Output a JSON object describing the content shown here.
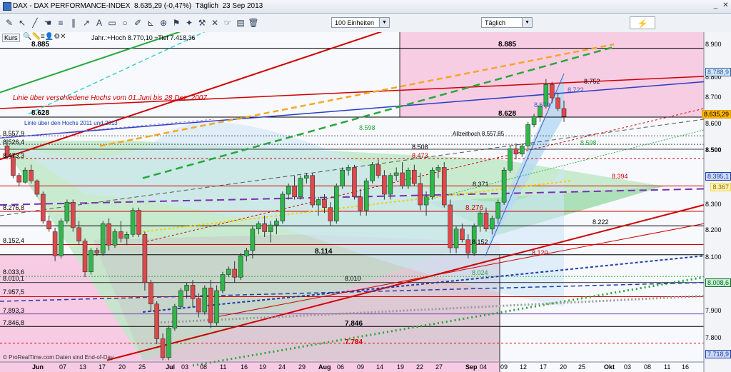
{
  "window": {
    "title": "DAX - DAX PERFORMANCE-INDEX",
    "price": "8.635,29 (-0,47%)",
    "interval": "Täglich",
    "date": "23 Sep 2013"
  },
  "toolbar": {
    "units_value": "100 Einheiten",
    "period_value": "Täglich"
  },
  "chart": {
    "kurs_label": "Kurs",
    "hilo": "Jahr.:+Hoch 8.770,10 ÷Tief 7.418,36",
    "annotation_red": "Linie über verschiedene Hochs vom 01.Juni bis 28.Dez. 2007",
    "annotation_blue": "Linie über den Hochs 2011 und 2013",
    "allzeithoch": "Allzeithoch 8.557,85",
    "footer": "© ProRealTime.com  Daten sind End-of-Day",
    "big_labels": {
      "l8885a": "8.885",
      "l8885b": "8.885",
      "l8628a": "8.628",
      "l8628b": "8.628",
      "l8114": "8.114",
      "l7846": "7.846",
      "l7784": "7.784"
    },
    "small_labels": {
      "l8752": "8.752",
      "l8722": "8.722",
      "l8679": "8.679",
      "l8598": "8.598",
      "l8598b": "8.598",
      "l8557": "8.557,9",
      "l8526": "8.526,4",
      "l8508": "8.508",
      "l8473a": "8.473,3",
      "l8473b": "8.473",
      "l8394": "8.394",
      "l8371": "8.371",
      "l8276a": "8.276,8",
      "l8276b": "8.276",
      "l8222": "8.222",
      "l8152a": "8.152,4",
      "l8152b": "8.152",
      "l8120": "8.120",
      "l8033": "8.033,6",
      "l8024": "8.024",
      "l8010a": "8.010,1",
      "l8010b": "8.010",
      "l7957": "7.957,5",
      "l7893": "7.893,3",
      "l7846s": "7.846,8"
    },
    "price_axis": [
      "8.900",
      "8.800",
      "8.700",
      "8.600",
      "8.500",
      "8.300",
      "8.200",
      "8.100",
      "7.900",
      "7.800"
    ],
    "price_boxes": {
      "last": "8.635,29",
      "b8395": "8.395,1",
      "b8008": "8.008,6",
      "b7718": "7.718,9",
      "b8788": "8.788,9",
      "b8367": "8.367"
    },
    "x_axis": [
      "Jun",
      "07",
      "13",
      "17",
      "20",
      "25",
      "Jul",
      "03",
      "08",
      "11",
      "16",
      "19",
      "24",
      "29",
      "Aug",
      "06",
      "09",
      "14",
      "19",
      "22",
      "27",
      "Sep",
      "04",
      "09",
      "12",
      "17",
      "20",
      "25",
      "Okt",
      "03",
      "08",
      "11",
      "16"
    ],
    "colors": {
      "up": "#2fb84a",
      "down": "#e0484b",
      "pink": "#f5b8d8",
      "green_zone": "#bfe9c8",
      "blue_zone": "#cfe6f6"
    }
  },
  "chart_data": {
    "type": "candlestick",
    "title": "DAX - DAX PERFORMANCE-INDEX",
    "ylim": [
      7700,
      8920
    ],
    "candles": [
      [
        8520,
        8545,
        8470,
        8480
      ],
      [
        8480,
        8490,
        8400,
        8410
      ],
      [
        8410,
        8420,
        8370,
        8385
      ],
      [
        8385,
        8440,
        8380,
        8430
      ],
      [
        8430,
        8450,
        8380,
        8390
      ],
      [
        8390,
        8395,
        8330,
        8340
      ],
      [
        8340,
        8350,
        8230,
        8240
      ],
      [
        8240,
        8260,
        8200,
        8210
      ],
      [
        8200,
        8215,
        8090,
        8110
      ],
      [
        8110,
        8250,
        8100,
        8240
      ],
      [
        8240,
        8320,
        8230,
        8310
      ],
      [
        8310,
        8320,
        8200,
        8215
      ],
      [
        8215,
        8240,
        8150,
        8165
      ],
      [
        8165,
        8175,
        8030,
        8050
      ],
      [
        8050,
        8140,
        8040,
        8130
      ],
      [
        8130,
        8140,
        8110,
        8120
      ],
      [
        8120,
        8240,
        8110,
        8230
      ],
      [
        8230,
        8250,
        8130,
        8150
      ],
      [
        8150,
        8210,
        8140,
        8200
      ],
      [
        8200,
        8240,
        8160,
        8175
      ],
      [
        8175,
        8200,
        8150,
        8190
      ],
      [
        8190,
        8290,
        8180,
        8280
      ],
      [
        8280,
        8290,
        8180,
        8190
      ],
      [
        8190,
        8200,
        7980,
        8010
      ],
      [
        8010,
        8020,
        7900,
        7930
      ],
      [
        7930,
        7940,
        7780,
        7800
      ],
      [
        7800,
        7820,
        7720,
        7730
      ],
      [
        7730,
        7850,
        7720,
        7840
      ],
      [
        7840,
        7930,
        7830,
        7920
      ],
      [
        7920,
        7990,
        7910,
        7980
      ],
      [
        7980,
        8010,
        7950,
        8000
      ],
      [
        8000,
        8020,
        7920,
        7950
      ],
      [
        7950,
        7970,
        7880,
        7900
      ],
      [
        7900,
        8000,
        7890,
        7990
      ],
      [
        7990,
        8020,
        7840,
        7860
      ],
      [
        7860,
        8000,
        7850,
        7980
      ],
      [
        7980,
        8050,
        7970,
        8040
      ],
      [
        8040,
        8070,
        8030,
        8060
      ],
      [
        8060,
        8090,
        8010,
        8030
      ],
      [
        8030,
        8120,
        8020,
        8110
      ],
      [
        8110,
        8140,
        8090,
        8130
      ],
      [
        8130,
        8220,
        8100,
        8210
      ],
      [
        8210,
        8240,
        8190,
        8230
      ],
      [
        8230,
        8260,
        8180,
        8200
      ],
      [
        8200,
        8240,
        8160,
        8225
      ],
      [
        8225,
        8250,
        8190,
        8240
      ],
      [
        8240,
        8350,
        8230,
        8340
      ],
      [
        8340,
        8380,
        8320,
        8370
      ],
      [
        8370,
        8410,
        8320,
        8330
      ],
      [
        8330,
        8410,
        8320,
        8400
      ],
      [
        8400,
        8420,
        8380,
        8410
      ],
      [
        8410,
        8420,
        8290,
        8300
      ],
      [
        8300,
        8330,
        8260,
        8320
      ],
      [
        8320,
        8340,
        8270,
        8290
      ],
      [
        8290,
        8310,
        8220,
        8240
      ],
      [
        8240,
        8380,
        8230,
        8370
      ],
      [
        8370,
        8440,
        8360,
        8430
      ],
      [
        8430,
        8450,
        8410,
        8440
      ],
      [
        8440,
        8450,
        8320,
        8330
      ],
      [
        8330,
        8360,
        8260,
        8280
      ],
      [
        8280,
        8400,
        8260,
        8390
      ],
      [
        8390,
        8460,
        8380,
        8450
      ],
      [
        8450,
        8470,
        8400,
        8410
      ],
      [
        8410,
        8430,
        8320,
        8340
      ],
      [
        8340,
        8420,
        8320,
        8410
      ],
      [
        8410,
        8440,
        8390,
        8420
      ],
      [
        8420,
        8460,
        8360,
        8370
      ],
      [
        8370,
        8440,
        8360,
        8430
      ],
      [
        8430,
        8450,
        8370,
        8380
      ],
      [
        8380,
        8420,
        8280,
        8300
      ],
      [
        8300,
        8350,
        8260,
        8330
      ],
      [
        8330,
        8440,
        8320,
        8430
      ],
      [
        8430,
        8450,
        8400,
        8440
      ],
      [
        8440,
        8460,
        8290,
        8300
      ],
      [
        8300,
        8320,
        8120,
        8140
      ],
      [
        8140,
        8220,
        8120,
        8210
      ],
      [
        8210,
        8230,
        8160,
        8170
      ],
      [
        8170,
        8190,
        8100,
        8120
      ],
      [
        8120,
        8230,
        8110,
        8220
      ],
      [
        8220,
        8280,
        8200,
        8270
      ],
      [
        8270,
        8290,
        8200,
        8210
      ],
      [
        8210,
        8260,
        8190,
        8250
      ],
      [
        8250,
        8320,
        8230,
        8310
      ],
      [
        8310,
        8440,
        8300,
        8430
      ],
      [
        8430,
        8520,
        8420,
        8510
      ],
      [
        8510,
        8530,
        8470,
        8490
      ],
      [
        8490,
        8530,
        8480,
        8520
      ],
      [
        8520,
        8610,
        8510,
        8600
      ],
      [
        8600,
        8640,
        8590,
        8630
      ],
      [
        8630,
        8680,
        8610,
        8670
      ],
      [
        8670,
        8770,
        8660,
        8750
      ],
      [
        8750,
        8760,
        8680,
        8700
      ],
      [
        8700,
        8720,
        8650,
        8660
      ],
      [
        8660,
        8690,
        8610,
        8630
      ]
    ],
    "levels": [
      8885,
      8752,
      8628,
      8557.9,
      8526.4,
      8508,
      8473,
      8394,
      8371,
      8276,
      8222,
      8152,
      8120,
      8114,
      8033,
      8010,
      7957.5,
      7893,
      7846,
      7784
    ]
  }
}
